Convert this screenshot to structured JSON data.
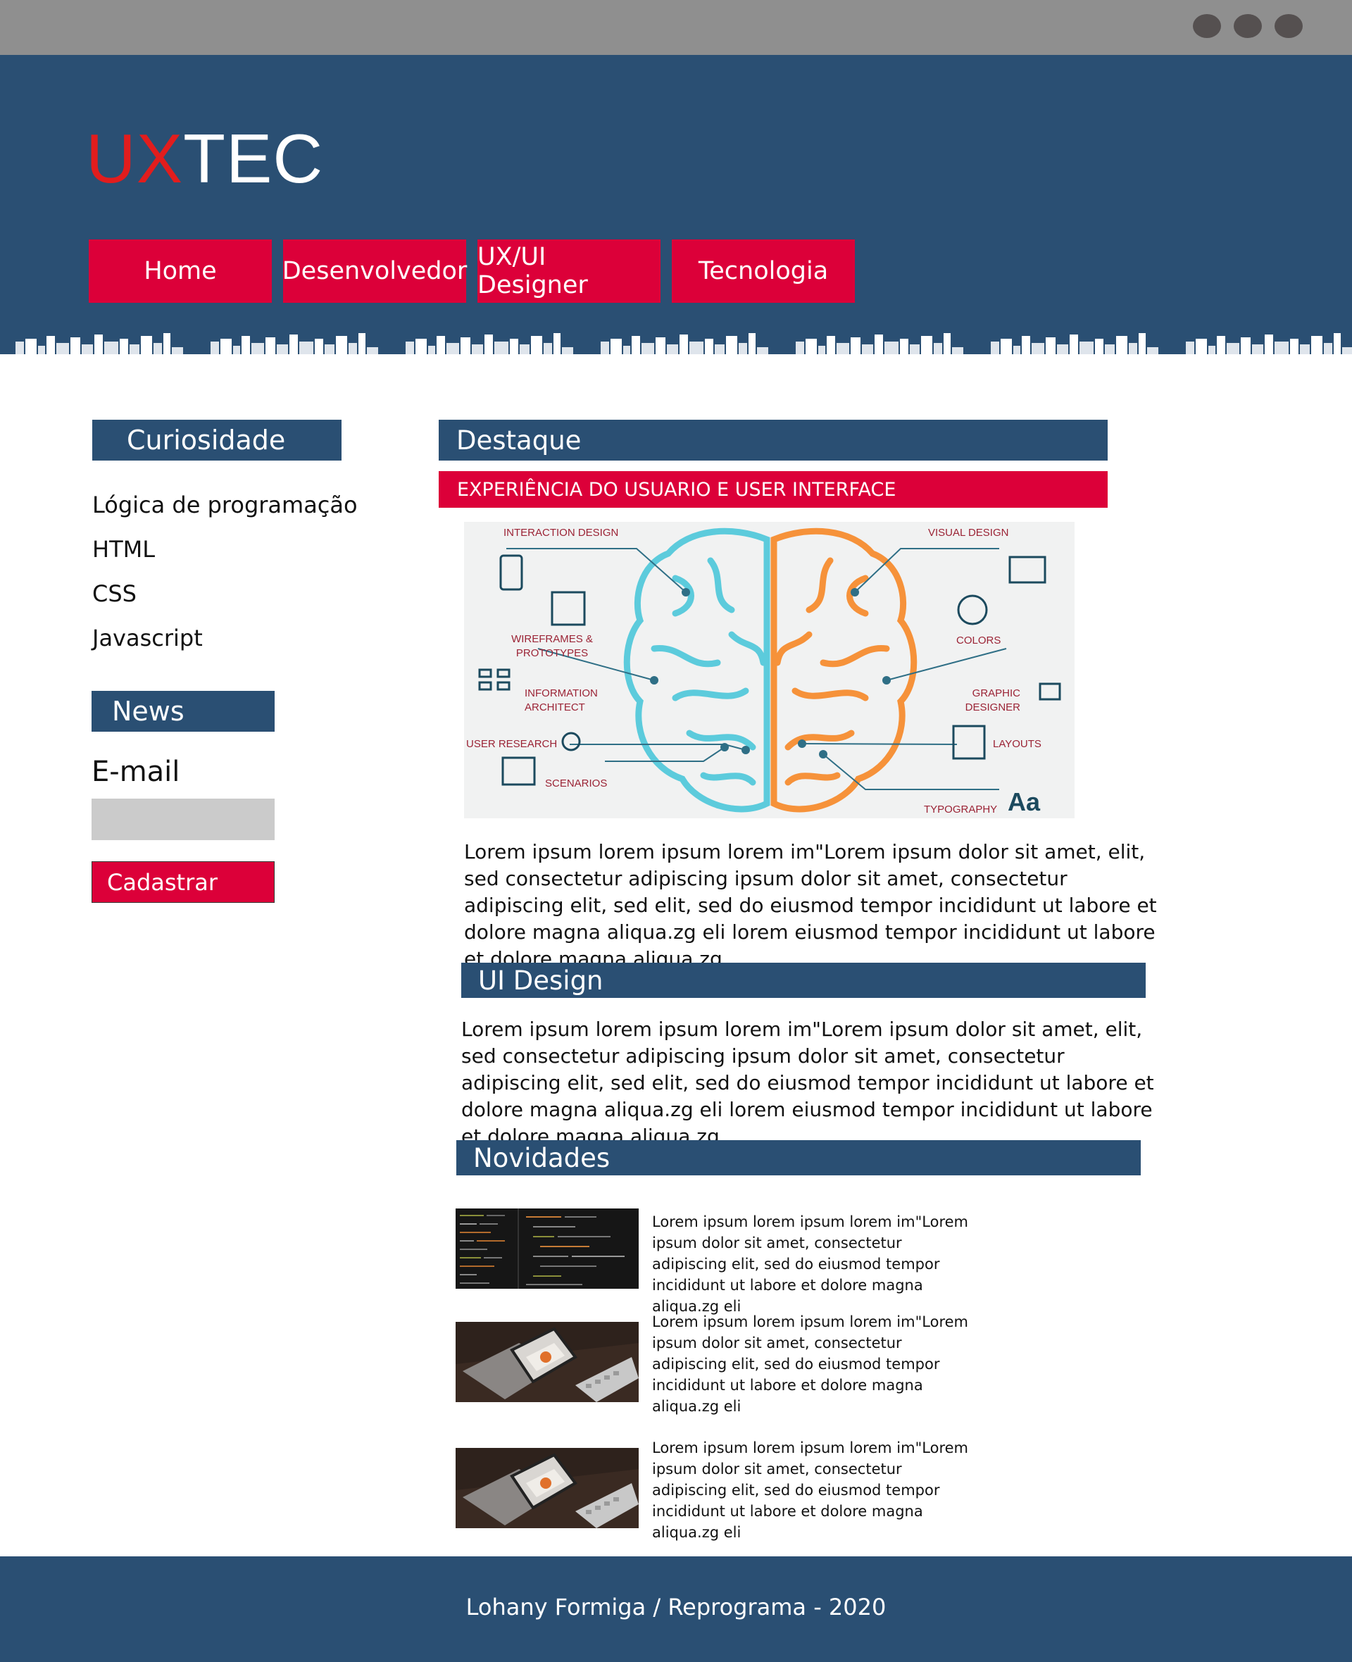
{
  "logo": {
    "part1": "UX",
    "part2": "TEC"
  },
  "nav": [
    {
      "label": "Home"
    },
    {
      "label": "Desenvolvedor"
    },
    {
      "label": "UX/UI Designer"
    },
    {
      "label": "Tecnologia"
    }
  ],
  "sidebar": {
    "curiosidade_title": "Curiosidade",
    "links": [
      "Lógica de programação",
      "HTML",
      "CSS",
      "Javascript"
    ],
    "news_title": "News",
    "email_label": "E-mail",
    "email_value": "",
    "submit_label": "Cadastrar"
  },
  "main": {
    "destaque_title": "Destaque",
    "subheading": "EXPERIÊNCIA DO USUARIO E USER INTERFACE",
    "infographic_labels": {
      "interaction_design": "Interaction design",
      "wireframes_1": "Wireframes &",
      "wireframes_2": "Prototypes",
      "information_1": "Information",
      "information_2": "Architect",
      "user_research": "User research",
      "scenarios": "Scenarios",
      "visual_design": "Visual design",
      "colors": "Colors",
      "graphic_1": "Graphic",
      "graphic_2": "Designer",
      "layouts": "Layouts",
      "typography": "Typography",
      "aa": "Aa"
    },
    "paragraph": "Lorem ipsum lorem ipsum lorem im\"Lorem ipsum dolor sit amet, elit, sed consectetur adipiscing ipsum dolor sit amet, consectetur adipiscing elit, sed elit, sed do eiusmod tempor incididunt ut labore et dolore magna aliqua.zg eli lorem eiusmod tempor incididunt ut labore et dolore magna aliqua.zg.",
    "ui_design_title": "UI Design",
    "ui_paragraph": "Lorem ipsum lorem ipsum lorem im\"Lorem ipsum dolor sit amet, elit, sed consectetur adipiscing ipsum dolor sit amet, consectetur adipiscing elit, sed elit, sed do eiusmod tempor incididunt ut labore et dolore magna aliqua.zg eli lorem eiusmod tempor incididunt ut labore et dolore magna aliqua.zg.",
    "novidades_title": "Novidades",
    "news_items": [
      {
        "text": "Lorem ipsum lorem ipsum lorem im\"Lorem ipsum dolor sit amet, consectetur adipiscing elit, sed do eiusmod tempor incididunt ut  labore et dolore magna aliqua.zg eli",
        "image": "code-screen"
      },
      {
        "text": "Lorem ipsum lorem ipsum lorem im\"Lorem ipsum dolor sit amet, consectetur adipiscing elit, sed do eiusmod tempor incididunt ut  labore et dolore magna aliqua.zg eli",
        "image": "phone-on-desk"
      },
      {
        "text": "Lorem ipsum lorem ipsum lorem im\"Lorem ipsum dolor sit amet, consectetur adipiscing elit, sed do eiusmod tempor incididunt ut  labore et dolore magna aliqua.zg eli",
        "image": "phone-on-desk"
      }
    ]
  },
  "footer": {
    "text": "Lohany Formiga / Reprograma - 2020"
  },
  "colors": {
    "navy": "#2a4f73",
    "crimson": "#dc0039",
    "chrome": "#8f8f8f",
    "logo_red": "#e21d1d"
  }
}
